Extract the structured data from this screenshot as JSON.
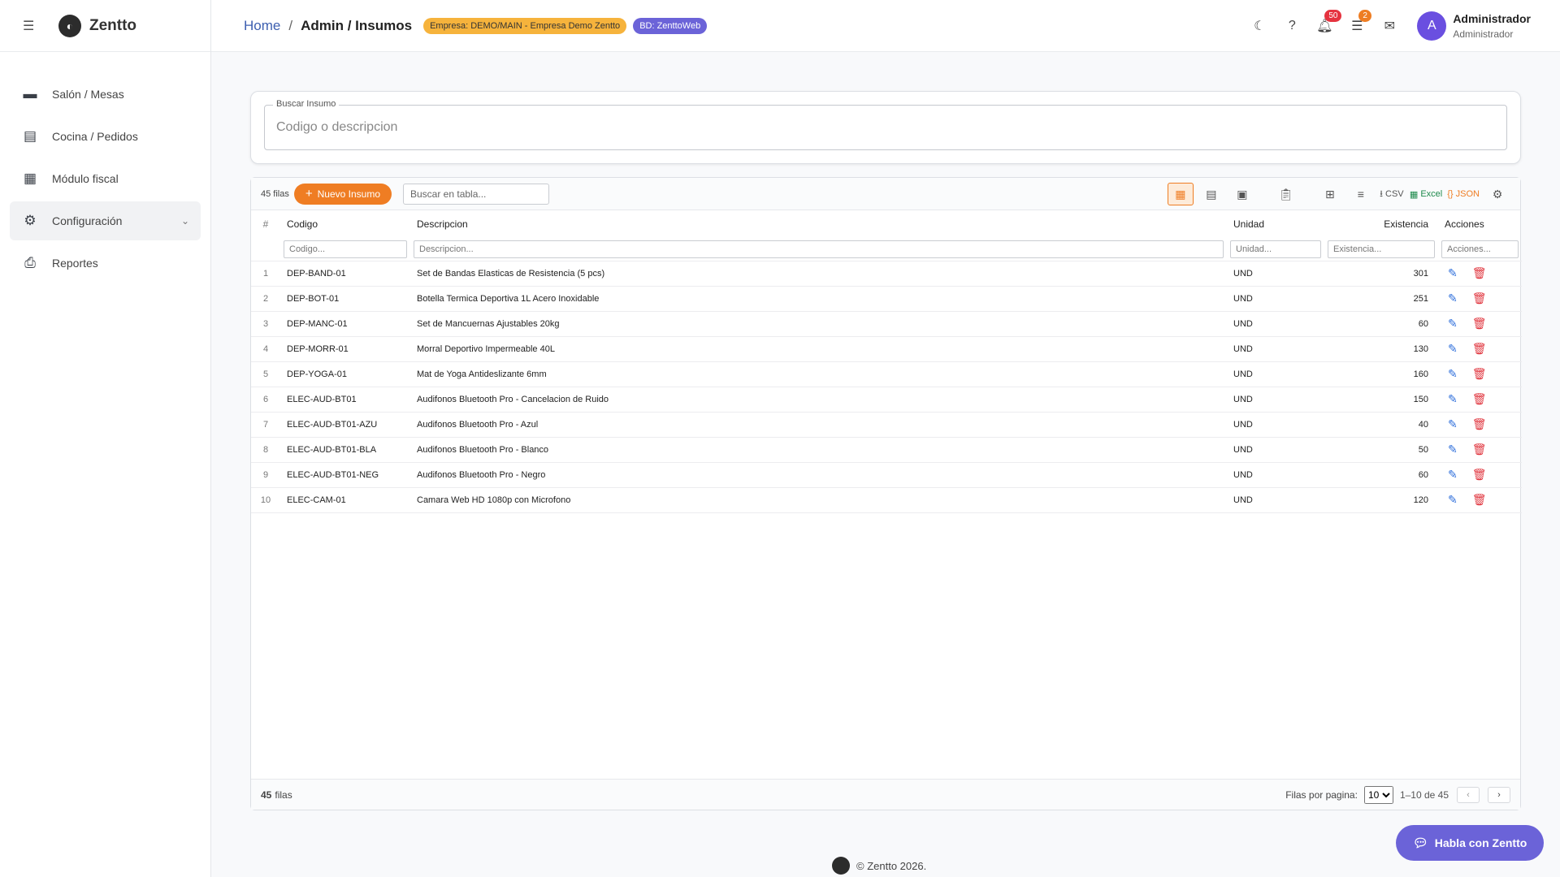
{
  "app": {
    "name": "Zentto"
  },
  "sidebar": {
    "items": [
      {
        "label": "Salón / Mesas"
      },
      {
        "label": "Cocina / Pedidos"
      },
      {
        "label": "Módulo fiscal"
      },
      {
        "label": "Configuración"
      },
      {
        "label": "Reportes"
      }
    ]
  },
  "header": {
    "breadcrumb_home": "Home",
    "breadcrumb_sep": "/",
    "breadcrumb_current": "Admin / Insumos",
    "company_badge": "Empresa: DEMO/MAIN - Empresa Demo Zentto",
    "db_badge": "BD: ZenttoWeb",
    "notifications_count": "50",
    "tasks_count": "2",
    "avatar_initial": "A",
    "user_name": "Administrador",
    "user_role": "Administrador"
  },
  "search": {
    "legend": "Buscar Insumo",
    "placeholder": "Codigo o descripcion"
  },
  "toolbar": {
    "rows_count": "45 filas",
    "new_button": "Nuevo Insumo",
    "table_search_placeholder": "Buscar en tabla...",
    "csv": "CSV",
    "excel": "Excel",
    "json": "JSON"
  },
  "table": {
    "columns": [
      "#",
      "Codigo",
      "Descripcion",
      "Unidad",
      "Existencia",
      "Acciones"
    ],
    "filters": [
      "Codigo...",
      "Descripcion...",
      "Unidad...",
      "Existencia...",
      "Acciones..."
    ],
    "rows": [
      [
        "1",
        "DEP-BAND-01",
        "Set de Bandas Elasticas de Resistencia (5 pcs)",
        "UND",
        "301"
      ],
      [
        "2",
        "DEP-BOT-01",
        "Botella Termica Deportiva 1L Acero Inoxidable",
        "UND",
        "251"
      ],
      [
        "3",
        "DEP-MANC-01",
        "Set de Mancuernas Ajustables 20kg",
        "UND",
        "60"
      ],
      [
        "4",
        "DEP-MORR-01",
        "Morral Deportivo Impermeable 40L",
        "UND",
        "130"
      ],
      [
        "5",
        "DEP-YOGA-01",
        "Mat de Yoga Antideslizante 6mm",
        "UND",
        "160"
      ],
      [
        "6",
        "ELEC-AUD-BT01",
        "Audifonos Bluetooth Pro - Cancelacion de Ruido",
        "UND",
        "150"
      ],
      [
        "7",
        "ELEC-AUD-BT01-AZU",
        "Audifonos Bluetooth Pro - Azul",
        "UND",
        "40"
      ],
      [
        "8",
        "ELEC-AUD-BT01-BLA",
        "Audifonos Bluetooth Pro - Blanco",
        "UND",
        "50"
      ],
      [
        "9",
        "ELEC-AUD-BT01-NEG",
        "Audifonos Bluetooth Pro - Negro",
        "UND",
        "60"
      ],
      [
        "10",
        "ELEC-CAM-01",
        "Camara Web HD 1080p con Microfono",
        "UND",
        "120"
      ]
    ]
  },
  "footer_bar": {
    "count_strong": "45",
    "count_label": "filas",
    "rows_per_page_label": "Filas por pagina:",
    "rows_per_page": "10",
    "range": "1–10 de 45",
    "prev": "‹",
    "next": "›"
  },
  "footer": {
    "copyright": "© Zentto 2026."
  },
  "chat": {
    "label": "Habla con Zentto"
  }
}
